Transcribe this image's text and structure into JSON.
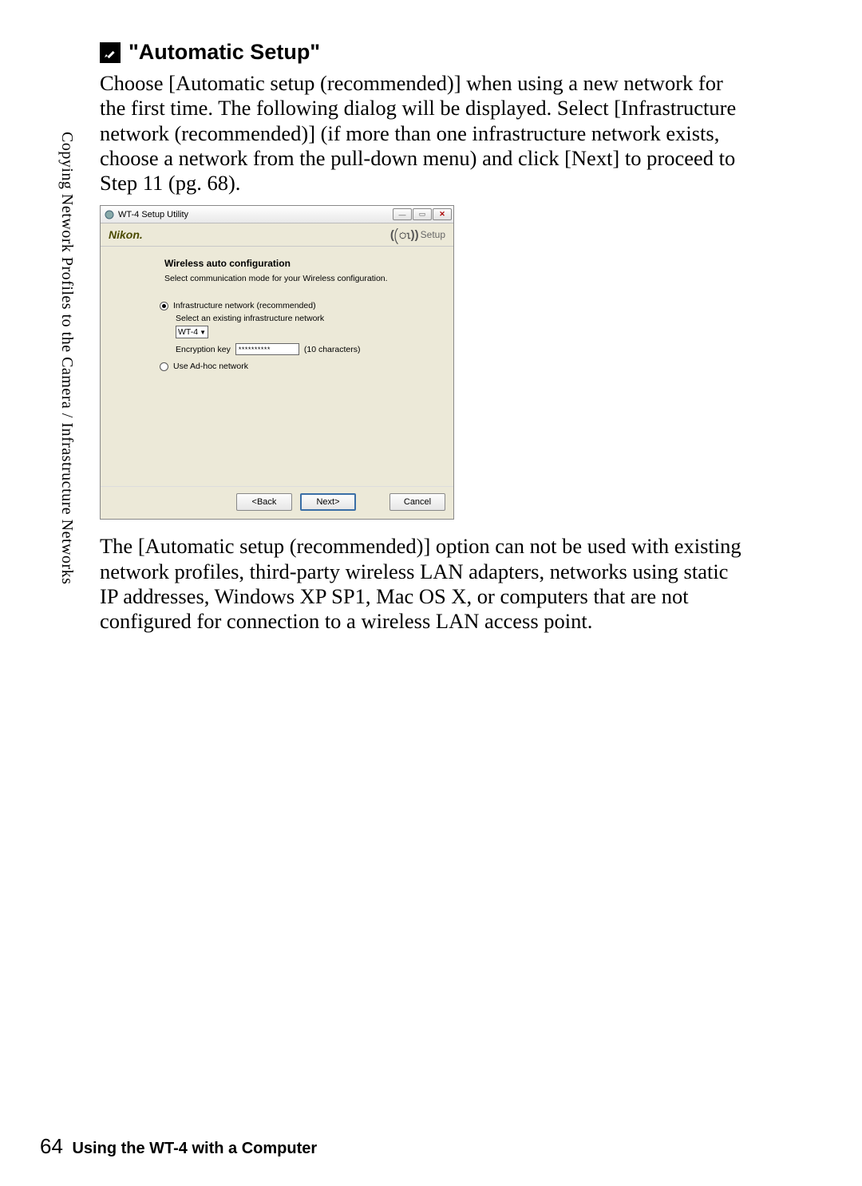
{
  "sidebar": "Copying Network Profiles to the Camera / Infrastructure Networks",
  "heading": "\"Automatic Setup\"",
  "para1": "Choose [Automatic setup (recommended)] when using a new network for the first time.  The following dialog will be displayed.  Select [Infrastructure network (recommended)] (if more than one infrastructure network exists, choose a network from the pull-down menu) and click [Next] to proceed to Step 11 (pg. 68).",
  "dialog": {
    "title": "WT-4 Setup Utility",
    "brand": "Nikon.",
    "setup": "Setup",
    "wiz_title": "Wireless auto configuration",
    "wiz_sub": "Select communication mode for your Wireless configuration.",
    "radio1": "Infrastructure network (recommended)",
    "select_label": "Select an existing infrastructure network",
    "select_value": "WT-4",
    "enc_label": "Encryption key",
    "enc_value": "**********",
    "enc_note": "(10 characters)",
    "radio2": "Use Ad-hoc network",
    "back": "<Back",
    "next": "Next>",
    "cancel": "Cancel"
  },
  "para2": "The [Automatic setup (recommended)] option can not be used with existing network profiles, third-party wireless LAN adapters, networks using static IP addresses, Windows XP SP1, Mac OS X, or computers that are not configured for connection to a wireless LAN access point.",
  "footer": {
    "page": "64",
    "text": "Using the WT-4 with a Computer"
  }
}
